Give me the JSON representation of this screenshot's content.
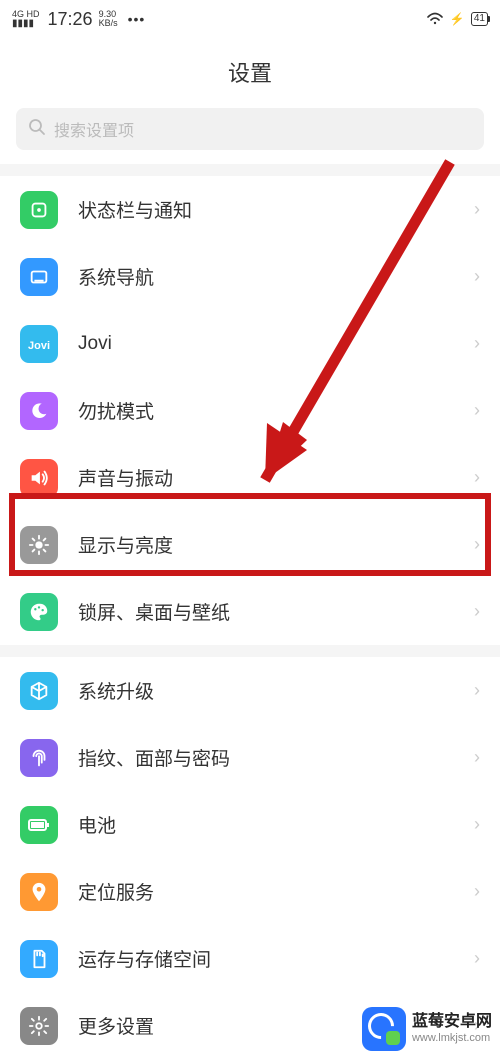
{
  "statusbar": {
    "network_type": "4G HD",
    "time": "17:26",
    "speed_val": "9.30",
    "speed_unit": "KB/s",
    "battery": "41"
  },
  "header": {
    "title": "设置"
  },
  "search": {
    "placeholder": "搜索设置项"
  },
  "groups": [
    {
      "items": [
        {
          "key": "status-notify",
          "label": "状态栏与通知",
          "icon": "square-dot",
          "bg": "#33cc66"
        },
        {
          "key": "system-nav",
          "label": "系统导航",
          "icon": "nav",
          "bg": "#3399ff"
        },
        {
          "key": "jovi",
          "label": "Jovi",
          "icon": "jovi",
          "bg": "#33bbee"
        },
        {
          "key": "dnd",
          "label": "勿扰模式",
          "icon": "moon",
          "bg": "#b266ff"
        },
        {
          "key": "sound",
          "label": "声音与振动",
          "icon": "speaker",
          "bg": "#ff5544"
        },
        {
          "key": "display",
          "label": "显示与亮度",
          "icon": "brightness",
          "bg": "#999999",
          "highlight": true
        },
        {
          "key": "lockscreen",
          "label": "锁屏、桌面与壁纸",
          "icon": "palette",
          "bg": "#33cc88"
        }
      ]
    },
    {
      "items": [
        {
          "key": "system-update",
          "label": "系统升级",
          "icon": "cube",
          "bg": "#33bbee"
        },
        {
          "key": "biometrics",
          "label": "指纹、面部与密码",
          "icon": "fingerprint",
          "bg": "#8866ee"
        },
        {
          "key": "battery",
          "label": "电池",
          "icon": "battery",
          "bg": "#33cc66"
        },
        {
          "key": "location",
          "label": "定位服务",
          "icon": "location",
          "bg": "#ff9933"
        },
        {
          "key": "storage",
          "label": "运存与存储空间",
          "icon": "sd",
          "bg": "#33aaff"
        },
        {
          "key": "more",
          "label": "更多设置",
          "icon": "gear",
          "bg": "#888888"
        }
      ]
    }
  ],
  "watermark": {
    "title": "蓝莓安卓网",
    "url": "www.lmkjst.com"
  }
}
